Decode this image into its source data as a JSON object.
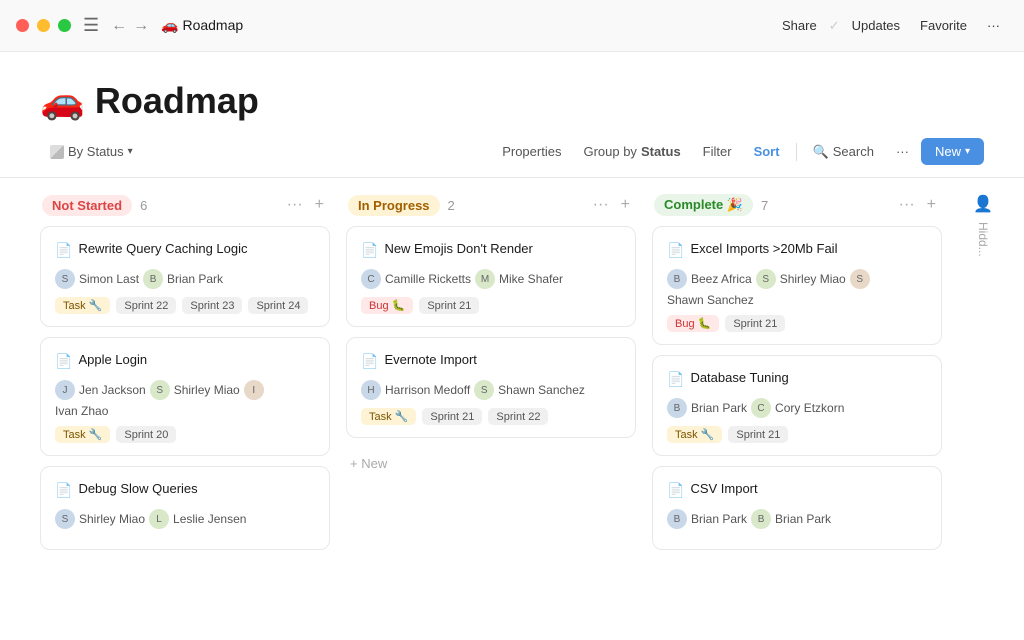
{
  "titlebar": {
    "title": "🚗 Roadmap",
    "actions": {
      "share": "Share",
      "updates": "Updates",
      "favorite": "Favorite",
      "more": "···"
    }
  },
  "page": {
    "emoji": "🚗",
    "title": "Roadmap"
  },
  "toolbar": {
    "by_status": "By Status",
    "properties": "Properties",
    "group_by": "Group by",
    "status": "Status",
    "filter": "Filter",
    "sort": "Sort",
    "search": "Search",
    "more": "···",
    "new": "New"
  },
  "columns": [
    {
      "id": "not-started",
      "label": "Not Started",
      "count": 6,
      "style": "not-started",
      "cards": [
        {
          "title": "Rewrite Query Caching Logic",
          "assignees": [
            "Simon Last",
            "Brian Park"
          ],
          "tags": [
            {
              "label": "Task 🔧",
              "type": "task"
            },
            {
              "label": "Sprint 22",
              "type": "sprint"
            },
            {
              "label": "Sprint 23",
              "type": "sprint"
            },
            {
              "label": "Sprint 24",
              "type": "sprint"
            }
          ]
        },
        {
          "title": "Apple Login",
          "assignees": [
            "Jen Jackson",
            "Shirley Miao",
            "Ivan Zhao"
          ],
          "tags": [
            {
              "label": "Task 🔧",
              "type": "task"
            },
            {
              "label": "Sprint 20",
              "type": "sprint"
            }
          ]
        },
        {
          "title": "Debug Slow Queries",
          "assignees": [
            "Shirley Miao",
            "Leslie Jensen"
          ],
          "tags": []
        }
      ]
    },
    {
      "id": "in-progress",
      "label": "In Progress",
      "count": 2,
      "style": "in-progress",
      "cards": [
        {
          "title": "New Emojis Don't Render",
          "assignees": [
            "Camille Ricketts",
            "Mike Shafer"
          ],
          "tags": [
            {
              "label": "Bug 🐛",
              "type": "bug"
            },
            {
              "label": "Sprint 21",
              "type": "sprint"
            }
          ]
        },
        {
          "title": "Evernote Import",
          "assignees": [
            "Harrison Medoff",
            "Shawn Sanchez"
          ],
          "tags": [
            {
              "label": "Task 🔧",
              "type": "task"
            },
            {
              "label": "Sprint 21",
              "type": "sprint"
            },
            {
              "label": "Sprint 22",
              "type": "sprint"
            }
          ]
        }
      ],
      "show_new": true
    },
    {
      "id": "complete",
      "label": "Complete 🎉",
      "count": 7,
      "style": "complete",
      "cards": [
        {
          "title": "Excel Imports >20Mb Fail",
          "assignees": [
            "Beez Africa",
            "Shirley Miao",
            "Shawn Sanchez"
          ],
          "tags": [
            {
              "label": "Bug 🐛",
              "type": "bug"
            },
            {
              "label": "Sprint 21",
              "type": "sprint"
            }
          ]
        },
        {
          "title": "Database Tuning",
          "assignees": [
            "Brian Park",
            "Cory Etzkorn"
          ],
          "tags": [
            {
              "label": "Task 🔧",
              "type": "task"
            },
            {
              "label": "Sprint 21",
              "type": "sprint"
            }
          ]
        },
        {
          "title": "CSV Import",
          "assignees": [
            "Brian Park",
            "Brian Park"
          ],
          "tags": []
        }
      ]
    }
  ],
  "hidden_col": {
    "label": "Hidd...",
    "icon": "👤"
  }
}
